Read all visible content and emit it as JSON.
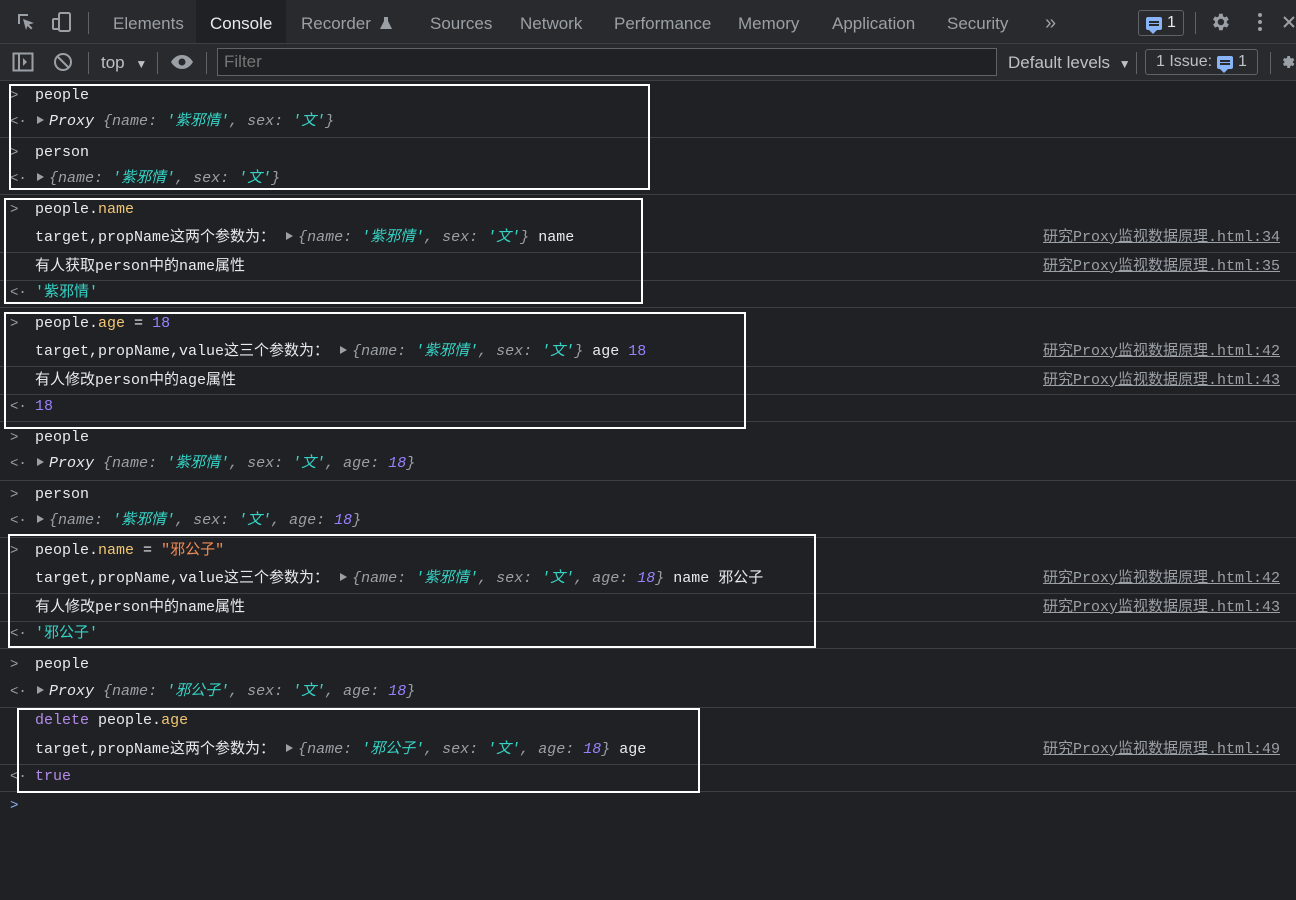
{
  "tabs": [
    "Elements",
    "Console",
    "Recorder",
    "Sources",
    "Network",
    "Performance",
    "Memory",
    "Application",
    "Security"
  ],
  "messages_count": "1",
  "toolbar": {
    "context": "top",
    "filter_placeholder": "Filter",
    "default_levels": "Default levels",
    "issues_label": "1 Issue:",
    "issues_count": "1"
  },
  "console": {
    "r1_input": "people",
    "r2_obj_label": "Proxy",
    "key_name": "name",
    "key_sex": "sex",
    "key_age": "age",
    "val_zixieqing": "'紫邪情'",
    "val_female": "'文'",
    "val_xiegongzi": "'邪公子'",
    "r3_input": "person",
    "r5_obj": "people",
    "r5_prop": "name",
    "r6_text": "target,propName这两个参数为：",
    "r6_tail": "name",
    "r6_src": "研究Proxy监视数据原理.html:34",
    "r7_text": "有人获取person中的name属性",
    "r7_src": "研究Proxy监视数据原理.html:35",
    "r8_result": "'紫邪情'",
    "r9_prop": "age",
    "r9_eq": " = ",
    "r9_val": "18",
    "r10_text": "target,propName,value这三个参数为：",
    "r10_tail": "age",
    "r10_num": "18",
    "r10_src": "研究Proxy监视数据原理.html:42",
    "r11_text": "有人修改person中的age属性",
    "r11_src": "研究Proxy监视数据原理.html:43",
    "r12_result": "18",
    "r15_val": "\"邪公子\"",
    "r16_tail": "name 邪公子",
    "r17_text": "有人修改person中的name属性",
    "r18_result": "'邪公子'",
    "r20_kw": "delete",
    "r21_src": "研究Proxy监视数据原理.html:49",
    "r22_result": "true",
    "age_val": "18"
  }
}
